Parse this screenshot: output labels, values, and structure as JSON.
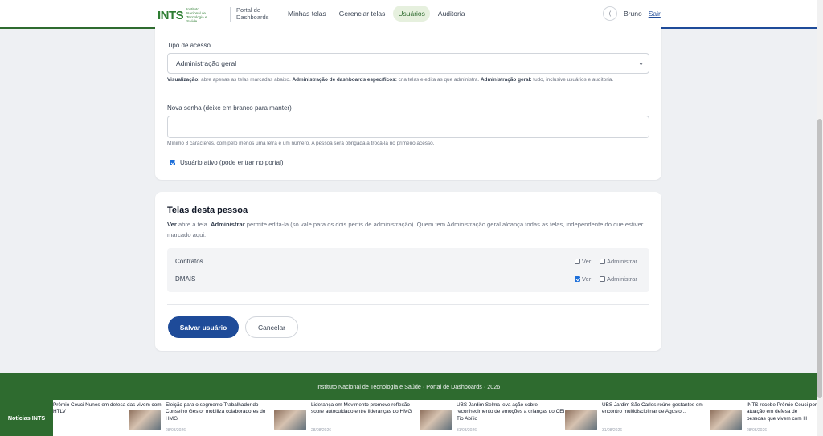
{
  "header": {
    "logo_text": "INTS",
    "logo_subtitle": "Instituto Nacional de Tecnologia e Saúde",
    "portal_name": "Portal de Dashboards",
    "nav": [
      {
        "label": "Minhas telas",
        "active": false
      },
      {
        "label": "Gerenciar telas",
        "active": false
      },
      {
        "label": "Usuários",
        "active": true
      },
      {
        "label": "Auditoria",
        "active": false
      }
    ],
    "avatar_initial": "(",
    "user_name": "Bruno",
    "logout_label": "Sair"
  },
  "form": {
    "access_label": "Tipo de acesso",
    "access_value": "Administração geral",
    "access_help": {
      "t1": "Visualização:",
      "d1": " abre apenas as telas marcadas abaixo. ",
      "t2": "Administração de dashboards específicos:",
      "d2": " cria telas e edita as que administra. ",
      "t3": "Administração geral:",
      "d3": " tudo, inclusive usuários e auditoria."
    },
    "password_label": "Nova senha (deixe em branco para manter)",
    "password_value": "",
    "password_help": "Mínimo 8 caracteres, com pelo menos uma letra e um número. A pessoa será obrigada a trocá-la no primeiro acesso.",
    "active_label": "Usuário ativo (pode entrar no portal)",
    "active_checked": true
  },
  "screens": {
    "title": "Telas desta pessoa",
    "desc": {
      "b1": "Ver",
      "t1": " abre a tela. ",
      "b2": "Administrar",
      "t2": " permite editá-la (só vale para os dois perfis de administração). Quem tem Administração geral alcança todas as telas, independente do que estiver marcado aqui."
    },
    "view_label": "Ver",
    "admin_label": "Administrar",
    "rows": [
      {
        "name": "Contratos",
        "view": false,
        "admin": false
      },
      {
        "name": "DMAIS",
        "view": true,
        "admin": false
      }
    ],
    "save_label": "Salvar usuário",
    "cancel_label": "Cancelar"
  },
  "footer": {
    "text": "Instituto Nacional de Tecnologia e Saúde  ·  Portal de Dashboards  ·  2026"
  },
  "ticker": {
    "label": "Notícias INTS",
    "items": [
      {
        "title": "Prêmio Ceuci Nunes em defesa das vivem com HTLV",
        "date": ""
      },
      {
        "title": "Eleição para o segmento Trabalhador do Conselho Gestor mobiliza colaboradores do HMG",
        "date": "28/08/2026"
      },
      {
        "title": "Liderança em Movimento promove reflexão sobre autocuidado entre lideranças do HMG",
        "date": "28/08/2026"
      },
      {
        "title": "UBS Jardim Selma leva ação sobre reconhecimento de emoções a crianças do CEI Tio Abílio",
        "date": "31/08/2026"
      },
      {
        "title": "UBS Jardim São Carlos reúne gestantes em encontro multidisciplinar de Agosto...",
        "date": "31/08/2026"
      },
      {
        "title": "INTS recebe Prêmio Ceuci por atuação em defesa de pessoas que vivem com H",
        "date": "28/08/2026"
      }
    ]
  },
  "colors": {
    "brand_green": "#2e6b2f",
    "brand_blue": "#1e4b99",
    "brand_yellow": "#f2c200",
    "checkbox_blue": "#1e6fd9"
  }
}
